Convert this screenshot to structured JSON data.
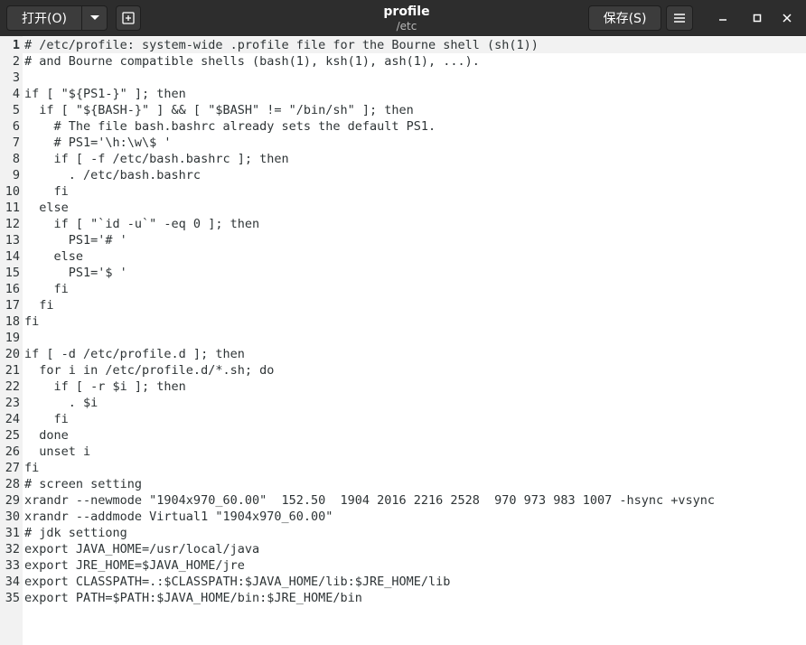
{
  "toolbar": {
    "open_label": "打开(O)",
    "save_label": "保存(S)"
  },
  "window": {
    "title": "profile",
    "subtitle": "/etc"
  },
  "editor": {
    "current_line": 1,
    "lines": [
      "# /etc/profile: system-wide .profile file for the Bourne shell (sh(1))",
      "# and Bourne compatible shells (bash(1), ksh(1), ash(1), ...).",
      "",
      "if [ \"${PS1-}\" ]; then",
      "  if [ \"${BASH-}\" ] && [ \"$BASH\" != \"/bin/sh\" ]; then",
      "    # The file bash.bashrc already sets the default PS1.",
      "    # PS1='\\h:\\w\\$ '",
      "    if [ -f /etc/bash.bashrc ]; then",
      "      . /etc/bash.bashrc",
      "    fi",
      "  else",
      "    if [ \"`id -u`\" -eq 0 ]; then",
      "      PS1='# '",
      "    else",
      "      PS1='$ '",
      "    fi",
      "  fi",
      "fi",
      "",
      "if [ -d /etc/profile.d ]; then",
      "  for i in /etc/profile.d/*.sh; do",
      "    if [ -r $i ]; then",
      "      . $i",
      "    fi",
      "  done",
      "  unset i",
      "fi",
      "# screen setting",
      "xrandr --newmode \"1904x970_60.00\"  152.50  1904 2016 2216 2528  970 973 983 1007 -hsync +vsync",
      "xrandr --addmode Virtual1 \"1904x970_60.00\"",
      "# jdk settiong",
      "export JAVA_HOME=/usr/local/java",
      "export JRE_HOME=$JAVA_HOME/jre",
      "export CLASSPATH=.:$CLASSPATH:$JAVA_HOME/lib:$JRE_HOME/lib",
      "export PATH=$PATH:$JAVA_HOME/bin:$JRE_HOME/bin"
    ]
  }
}
